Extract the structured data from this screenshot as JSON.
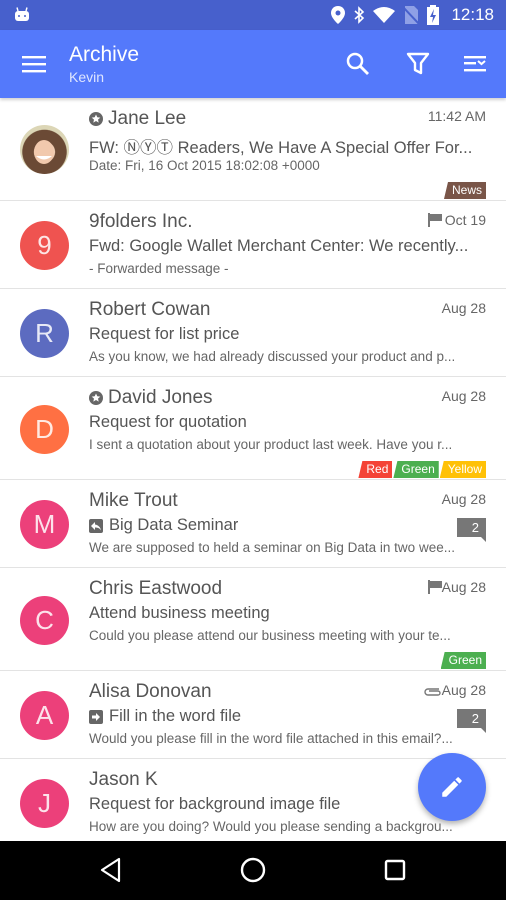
{
  "status_bar": {
    "time": "12:18",
    "icons": [
      "android-icon",
      "location-icon",
      "bluetooth-icon",
      "wifi-icon",
      "no-sim-icon",
      "battery-charging-icon"
    ]
  },
  "app_bar": {
    "title": "Archive",
    "subtitle": "Kevin",
    "actions": [
      "search-icon",
      "filter-icon",
      "select-list-icon"
    ],
    "color": "#5479fb"
  },
  "emails": [
    {
      "sender": "Jane Lee",
      "starred": true,
      "avatar_type": "photo",
      "date": "11:42 AM",
      "subject": "FW: ⓃⓎⓉ Readers, We Have A Special Offer For...",
      "preview": "Date: Fri, 16 Oct 2015 18:02:08 +0000",
      "tags": [
        {
          "label": "News",
          "color": "#795548"
        }
      ]
    },
    {
      "sender": "9folders Inc.",
      "avatar_letter": "9",
      "avatar_color": "#ef5350",
      "flagged": true,
      "date": "Oct 19",
      "subject": "Fwd: Google Wallet Merchant Center: We recently...",
      "preview": "- Forwarded message -"
    },
    {
      "sender": "Robert Cowan",
      "avatar_letter": "R",
      "avatar_color": "#5c6bc0",
      "date": "Aug 28",
      "subject": "Request for list price",
      "preview": "As you know, we had already discussed your product and p..."
    },
    {
      "sender": "David Jones",
      "starred": true,
      "avatar_letter": "D",
      "avatar_color": "#ff7043",
      "date": "Aug 28",
      "subject": "Request for quotation",
      "preview": "I sent a quotation about your product last week. Have you r...",
      "tags": [
        {
          "label": "Red",
          "color": "#f44336"
        },
        {
          "label": "Green",
          "color": "#4caf50"
        },
        {
          "label": "Yellow",
          "color": "#ffc107"
        }
      ]
    },
    {
      "sender": "Mike Trout",
      "avatar_letter": "M",
      "avatar_color": "#ec407a",
      "date": "Aug 28",
      "subject_icon": "reply-icon",
      "subject": "Big Data Seminar",
      "preview": "We are supposed to held a seminar on Big Data in two wee...",
      "thread_count": "2"
    },
    {
      "sender": "Chris Eastwood",
      "avatar_letter": "C",
      "avatar_color": "#ec407a",
      "flagged": true,
      "date": "Aug 28",
      "subject": "Attend business meeting",
      "preview": "Could you please attend our business meeting with your te...",
      "tags": [
        {
          "label": "Green",
          "color": "#4caf50"
        }
      ]
    },
    {
      "sender": "Alisa Donovan",
      "avatar_letter": "A",
      "avatar_color": "#ec407a",
      "attachment": true,
      "date": "Aug 28",
      "subject_icon": "forward-icon",
      "subject": "Fill in the word file",
      "preview": "Would you please fill in the word file attached in this email?...",
      "thread_count": "2"
    },
    {
      "sender": "Jason K",
      "avatar_letter": "J",
      "avatar_color": "#ec407a",
      "date": "",
      "subject": "Request for background image file",
      "preview": "How are you doing? Would you please sending a backgrou..."
    }
  ],
  "fab": {
    "icon": "pencil-icon",
    "label": "Compose"
  },
  "nav_bar": [
    "back-icon",
    "home-icon",
    "recents-icon"
  ]
}
